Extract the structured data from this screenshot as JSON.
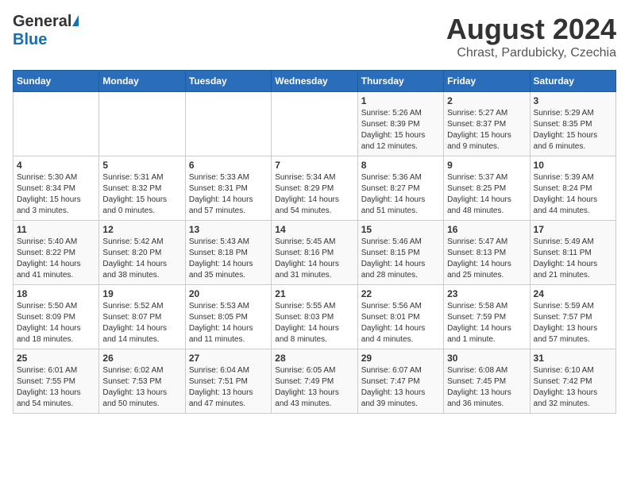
{
  "header": {
    "logo_general": "General",
    "logo_blue": "Blue",
    "title": "August 2024",
    "subtitle": "Chrast, Pardubicky, Czechia"
  },
  "days_of_week": [
    "Sunday",
    "Monday",
    "Tuesday",
    "Wednesday",
    "Thursday",
    "Friday",
    "Saturday"
  ],
  "weeks": [
    [
      {
        "day": "",
        "info": ""
      },
      {
        "day": "",
        "info": ""
      },
      {
        "day": "",
        "info": ""
      },
      {
        "day": "",
        "info": ""
      },
      {
        "day": "1",
        "info": "Sunrise: 5:26 AM\nSunset: 8:39 PM\nDaylight: 15 hours\nand 12 minutes."
      },
      {
        "day": "2",
        "info": "Sunrise: 5:27 AM\nSunset: 8:37 PM\nDaylight: 15 hours\nand 9 minutes."
      },
      {
        "day": "3",
        "info": "Sunrise: 5:29 AM\nSunset: 8:35 PM\nDaylight: 15 hours\nand 6 minutes."
      }
    ],
    [
      {
        "day": "4",
        "info": "Sunrise: 5:30 AM\nSunset: 8:34 PM\nDaylight: 15 hours\nand 3 minutes."
      },
      {
        "day": "5",
        "info": "Sunrise: 5:31 AM\nSunset: 8:32 PM\nDaylight: 15 hours\nand 0 minutes."
      },
      {
        "day": "6",
        "info": "Sunrise: 5:33 AM\nSunset: 8:31 PM\nDaylight: 14 hours\nand 57 minutes."
      },
      {
        "day": "7",
        "info": "Sunrise: 5:34 AM\nSunset: 8:29 PM\nDaylight: 14 hours\nand 54 minutes."
      },
      {
        "day": "8",
        "info": "Sunrise: 5:36 AM\nSunset: 8:27 PM\nDaylight: 14 hours\nand 51 minutes."
      },
      {
        "day": "9",
        "info": "Sunrise: 5:37 AM\nSunset: 8:25 PM\nDaylight: 14 hours\nand 48 minutes."
      },
      {
        "day": "10",
        "info": "Sunrise: 5:39 AM\nSunset: 8:24 PM\nDaylight: 14 hours\nand 44 minutes."
      }
    ],
    [
      {
        "day": "11",
        "info": "Sunrise: 5:40 AM\nSunset: 8:22 PM\nDaylight: 14 hours\nand 41 minutes."
      },
      {
        "day": "12",
        "info": "Sunrise: 5:42 AM\nSunset: 8:20 PM\nDaylight: 14 hours\nand 38 minutes."
      },
      {
        "day": "13",
        "info": "Sunrise: 5:43 AM\nSunset: 8:18 PM\nDaylight: 14 hours\nand 35 minutes."
      },
      {
        "day": "14",
        "info": "Sunrise: 5:45 AM\nSunset: 8:16 PM\nDaylight: 14 hours\nand 31 minutes."
      },
      {
        "day": "15",
        "info": "Sunrise: 5:46 AM\nSunset: 8:15 PM\nDaylight: 14 hours\nand 28 minutes."
      },
      {
        "day": "16",
        "info": "Sunrise: 5:47 AM\nSunset: 8:13 PM\nDaylight: 14 hours\nand 25 minutes."
      },
      {
        "day": "17",
        "info": "Sunrise: 5:49 AM\nSunset: 8:11 PM\nDaylight: 14 hours\nand 21 minutes."
      }
    ],
    [
      {
        "day": "18",
        "info": "Sunrise: 5:50 AM\nSunset: 8:09 PM\nDaylight: 14 hours\nand 18 minutes."
      },
      {
        "day": "19",
        "info": "Sunrise: 5:52 AM\nSunset: 8:07 PM\nDaylight: 14 hours\nand 14 minutes."
      },
      {
        "day": "20",
        "info": "Sunrise: 5:53 AM\nSunset: 8:05 PM\nDaylight: 14 hours\nand 11 minutes."
      },
      {
        "day": "21",
        "info": "Sunrise: 5:55 AM\nSunset: 8:03 PM\nDaylight: 14 hours\nand 8 minutes."
      },
      {
        "day": "22",
        "info": "Sunrise: 5:56 AM\nSunset: 8:01 PM\nDaylight: 14 hours\nand 4 minutes."
      },
      {
        "day": "23",
        "info": "Sunrise: 5:58 AM\nSunset: 7:59 PM\nDaylight: 14 hours\nand 1 minute."
      },
      {
        "day": "24",
        "info": "Sunrise: 5:59 AM\nSunset: 7:57 PM\nDaylight: 13 hours\nand 57 minutes."
      }
    ],
    [
      {
        "day": "25",
        "info": "Sunrise: 6:01 AM\nSunset: 7:55 PM\nDaylight: 13 hours\nand 54 minutes."
      },
      {
        "day": "26",
        "info": "Sunrise: 6:02 AM\nSunset: 7:53 PM\nDaylight: 13 hours\nand 50 minutes."
      },
      {
        "day": "27",
        "info": "Sunrise: 6:04 AM\nSunset: 7:51 PM\nDaylight: 13 hours\nand 47 minutes."
      },
      {
        "day": "28",
        "info": "Sunrise: 6:05 AM\nSunset: 7:49 PM\nDaylight: 13 hours\nand 43 minutes."
      },
      {
        "day": "29",
        "info": "Sunrise: 6:07 AM\nSunset: 7:47 PM\nDaylight: 13 hours\nand 39 minutes."
      },
      {
        "day": "30",
        "info": "Sunrise: 6:08 AM\nSunset: 7:45 PM\nDaylight: 13 hours\nand 36 minutes."
      },
      {
        "day": "31",
        "info": "Sunrise: 6:10 AM\nSunset: 7:42 PM\nDaylight: 13 hours\nand 32 minutes."
      }
    ]
  ]
}
